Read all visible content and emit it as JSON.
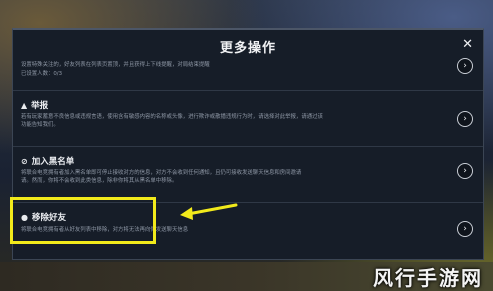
{
  "dialog": {
    "title": "更多操作",
    "close_icon": "close-icon"
  },
  "sections": [
    {
      "label": "",
      "desc_lines": [
        "设置特殊关注的，好友列表在列表页置顶，并且获得上下线提醒，对局结束提醒",
        "已设置人数：0/3"
      ]
    },
    {
      "label": "举报",
      "icon": "warning-icon",
      "desc_lines": [
        "若有玩家蓄意不良信息或违规言语，使用含有敏感内容的名称或头像，进行欺诈或散播违规行为时，请选择对此举报，请通过该",
        "功能告知我们。"
      ]
    },
    {
      "label": "加入黑名单",
      "icon": "block-icon",
      "desc_lines": [
        "将联合电竞拥有者加入黑名单即可停止接收对方的信息，对方不会收到任何通知，且仍可接收发送聊天信息和房间邀请",
        "请。然而，你将不会收到此类信息，除非你将其从黑名单中移除。"
      ]
    },
    {
      "label": "移除好友",
      "icon": "remove-friend-icon",
      "desc_lines": [
        "将联合电竞拥有者从好友列表中移除，对方将无法再向你发送聊天信息"
      ]
    }
  ],
  "annotation": {
    "highlight_color": "#f2ea1b"
  },
  "watermark": "风行手游网"
}
